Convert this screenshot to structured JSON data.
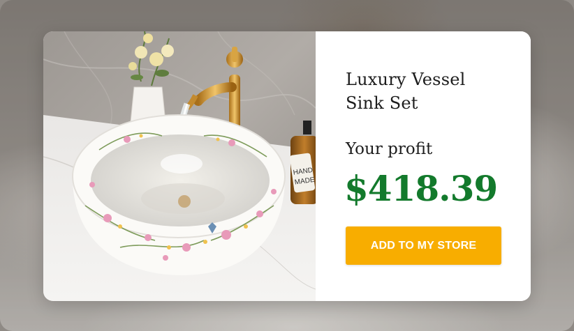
{
  "product": {
    "title_line1": "Luxury Vessel",
    "title_line2": "Sink Set",
    "profit_label": "Your profit",
    "profit_value": "$418.39",
    "add_button_label": "ADD TO MY STORE",
    "soap_label_line1": "HAND",
    "soap_label_line2": "MADE"
  },
  "colors": {
    "price": "#137a2c",
    "button": "#f8ad00",
    "button_text": "#ffffff"
  }
}
